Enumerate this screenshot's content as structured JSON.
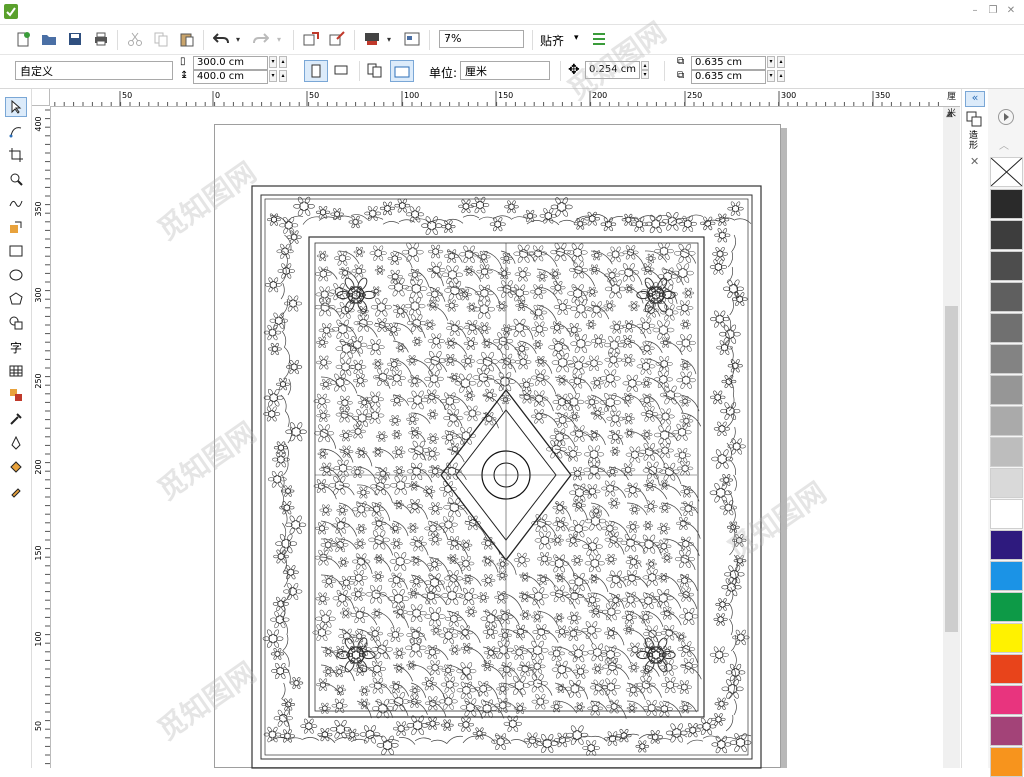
{
  "window": {
    "minimize": "–",
    "restore": "❐",
    "close": "✕"
  },
  "toolbar1": {
    "icons": [
      "new-document-icon",
      "open-icon",
      "save-icon",
      "print-icon",
      "cut-icon",
      "copy-icon",
      "paste-icon",
      "undo-icon",
      "redo-icon",
      "import-icon",
      "export-icon",
      "publish-icon",
      "app-launcher-icon"
    ],
    "zoom_value": "7%",
    "snap_label": "贴齐",
    "snap_arrow": "▾"
  },
  "toolbar2": {
    "page_preset": "自定义",
    "width": "300.0 cm",
    "height": "400.0 cm",
    "units_label": "单位:",
    "units_value": "厘米",
    "nudge": "0.254 cm",
    "dup_x": "0.635 cm",
    "dup_y": "0.635 cm"
  },
  "ruler": {
    "h_labels": [
      "50",
      "0",
      "50",
      "100",
      "150",
      "200",
      "250",
      "300",
      "350"
    ],
    "h_unit": "厘米",
    "v_labels": [
      "400",
      "350",
      "300",
      "250",
      "200",
      "150",
      "100",
      "50"
    ]
  },
  "toolbox": {
    "tools": [
      "pick-tool-icon",
      "shape-tool-icon",
      "crop-tool-icon",
      "zoom-tool-icon",
      "freehand-tool-icon",
      "smart-fill-icon",
      "rectangle-tool-icon",
      "ellipse-tool-icon",
      "polygon-tool-icon",
      "basic-shapes-icon",
      "text-tool-icon",
      "table-tool-icon",
      "parallel-dimension-icon",
      "connector-tool-icon",
      "eyedropper-tool-icon",
      "outline-pen-icon",
      "interactive-fill-icon",
      "smart-fill-tool-icon"
    ],
    "text_tool_glyph": "字"
  },
  "docker": {
    "expand": "«",
    "tab_label": "造形",
    "close": "✕"
  },
  "palette": {
    "colors": [
      "#2a2a2a",
      "#3d3d3d",
      "#4d4d4d",
      "#5f5f5f",
      "#707070",
      "#838383",
      "#969696",
      "#aaaaaa",
      "#bdbdbd",
      "#d9d9d9",
      "#ffffff",
      "#2e1a7e",
      "#1b93e6",
      "#0d9a47",
      "#fff200",
      "#e8441b",
      "#e8347e",
      "#a34378",
      "#f7941d"
    ]
  },
  "watermark": "觅知图网"
}
